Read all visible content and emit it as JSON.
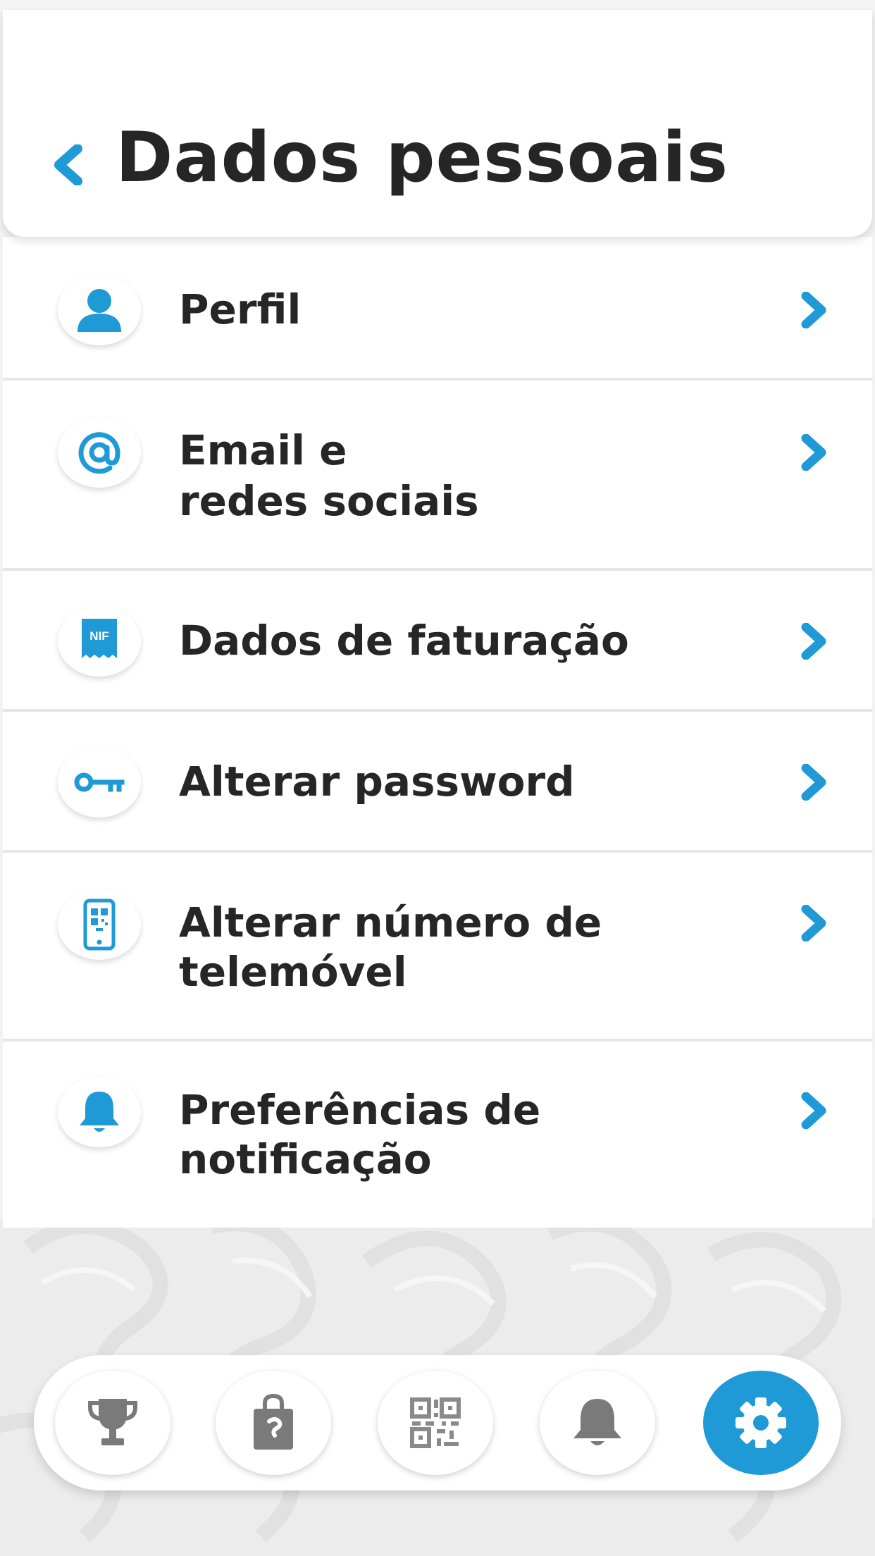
{
  "header": {
    "title": "Dados pessoais",
    "back_icon": "chevron-left-icon"
  },
  "colors": {
    "accent": "#1f9ad6",
    "text": "#262626",
    "nav_icon": "#7a7a7a"
  },
  "menu": {
    "items": [
      {
        "line1": "Perfil",
        "line2": "",
        "icon": "user-icon"
      },
      {
        "line1": "Email e",
        "line2": "redes sociais",
        "icon": "at-sign-icon"
      },
      {
        "line1": "Dados de faturação",
        "line2": "",
        "icon": "nif-receipt-icon",
        "icon_text": "NIF"
      },
      {
        "line1": "Alterar password",
        "line2": "",
        "icon": "key-icon"
      },
      {
        "line1": "Alterar número de",
        "line2": "telemóvel",
        "icon": "mobile-qr-icon"
      },
      {
        "line1": "Preferências de",
        "line2": "notificação",
        "icon": "bell-icon"
      }
    ]
  },
  "bottom_nav": {
    "items": [
      {
        "icon": "trophy-icon",
        "active": false
      },
      {
        "icon": "shopping-bag-icon",
        "active": false
      },
      {
        "icon": "qr-code-icon",
        "active": false
      },
      {
        "icon": "bell-icon",
        "active": false
      },
      {
        "icon": "gear-icon",
        "active": true
      }
    ]
  }
}
